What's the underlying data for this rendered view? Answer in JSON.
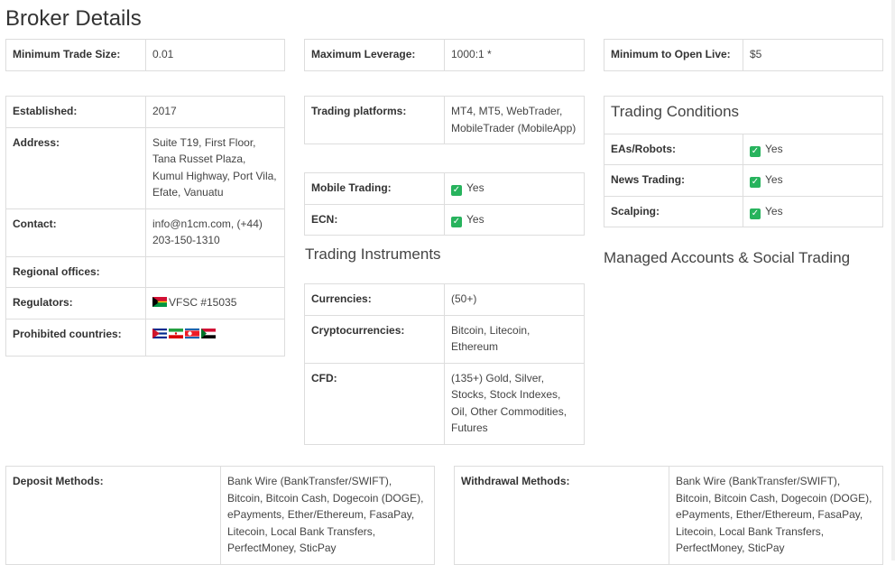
{
  "page": {
    "title": "Broker Details"
  },
  "top": {
    "min_trade_size": {
      "label": "Minimum Trade Size:",
      "value": "0.01"
    },
    "max_leverage": {
      "label": "Maximum Leverage:",
      "value": "1000:1 *"
    },
    "min_open_live": {
      "label": "Minimum to Open Live:",
      "value": "$5"
    }
  },
  "info": {
    "established": {
      "label": "Established:",
      "value": "2017"
    },
    "address": {
      "label": "Address:",
      "value": "Suite T19, First Floor, Tana Russet Plaza, Kumul Highway, Port Vila, Efate, Vanuatu"
    },
    "contact": {
      "label": "Contact:",
      "value": "info@n1cm.com, (+44) 203-150-1310"
    },
    "regional_offices": {
      "label": "Regional offices:",
      "value": ""
    },
    "regulators": {
      "label": "Regulators:",
      "value": "VFSC #15035",
      "flag_icon": "vanuatu-flag-icon"
    },
    "prohibited": {
      "label": "Prohibited countries:",
      "flags": [
        "cuba-flag-icon",
        "iran-flag-icon",
        "north-korea-flag-icon",
        "sudan-flag-icon"
      ]
    }
  },
  "platforms": {
    "trading_platforms": {
      "label": "Trading platforms:",
      "value": "MT4, MT5, WebTrader, MobileTrader (MobileApp)"
    },
    "mobile_trading": {
      "label": "Mobile Trading:",
      "value": "Yes"
    },
    "ecn": {
      "label": "ECN:",
      "value": "Yes"
    }
  },
  "instruments": {
    "title": "Trading Instruments",
    "currencies": {
      "label": "Currencies:",
      "value": "(50+)"
    },
    "crypto": {
      "label": "Cryptocurrencies:",
      "value": "Bitcoin, Litecoin, Ethereum"
    },
    "cfd": {
      "label": "CFD:",
      "value": "(135+) Gold, Silver, Stocks, Stock Indexes, Oil, Other Commodities, Futures"
    }
  },
  "conditions": {
    "title": "Trading Conditions",
    "eas": {
      "label": "EAs/Robots:",
      "value": "Yes"
    },
    "news": {
      "label": "News Trading:",
      "value": "Yes"
    },
    "scalping": {
      "label": "Scalping:",
      "value": "Yes"
    }
  },
  "managed": {
    "title": "Managed Accounts & Social Trading"
  },
  "methods": {
    "deposit": {
      "label": "Deposit Methods:",
      "value": "Bank Wire (BankTransfer/SWIFT), Bitcoin, Bitcoin Cash, Dogecoin (DOGE), ePayments, Ether/Ethereum, FasaPay, Litecoin, Local Bank Transfers, PerfectMoney, SticPay"
    },
    "withdrawal": {
      "label": "Withdrawal Methods:",
      "value": "Bank Wire (BankTransfer/SWIFT), Bitcoin, Bitcoin Cash, Dogecoin (DOGE), ePayments, Ether/Ethereum, FasaPay, Litecoin, Local Bank Transfers, PerfectMoney, SticPay"
    }
  },
  "colors": {
    "check": "#27b35d",
    "border": "#dddddd",
    "text": "#333333"
  }
}
